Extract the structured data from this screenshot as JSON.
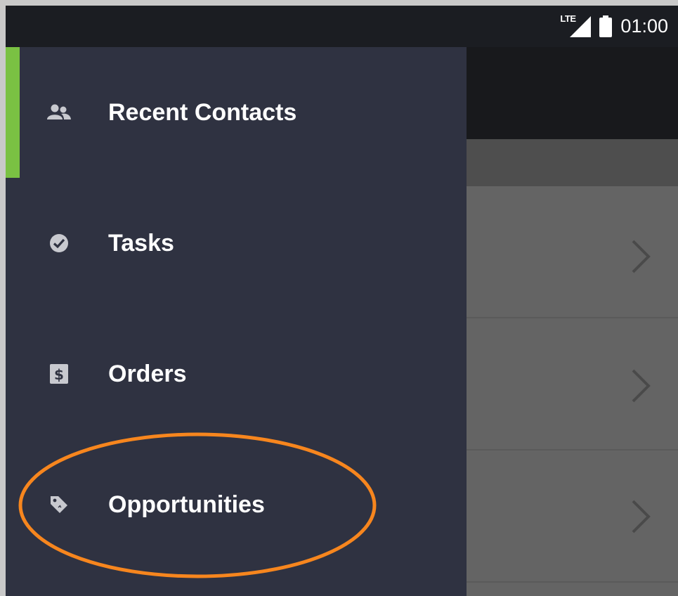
{
  "status_bar": {
    "network": "LTE",
    "time": "01:00"
  },
  "drawer": {
    "items": [
      {
        "label": "Recent Contacts",
        "icon": "contacts-icon",
        "active": true
      },
      {
        "label": "Tasks",
        "icon": "check-circle-icon",
        "active": false
      },
      {
        "label": "Orders",
        "icon": "dollar-icon",
        "active": false
      },
      {
        "label": "Opportunities",
        "icon": "tag-icon",
        "active": false
      }
    ]
  },
  "colors": {
    "drawer_bg": "#2f3241",
    "active_indicator": "#7ac143",
    "highlight_ring": "#f7861e",
    "status_bar_bg": "#1b1d22"
  }
}
